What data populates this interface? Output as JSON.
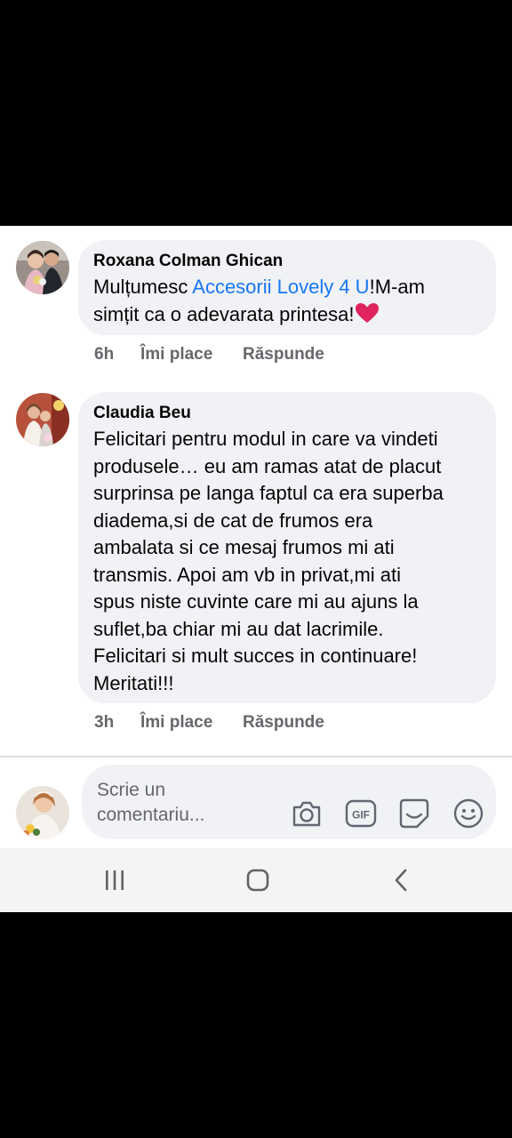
{
  "comments": [
    {
      "author": "Roxana Colman Ghican",
      "text_prefix": "Mulțumesc ",
      "mention": "Accesorii  Lovely 4 U",
      "text_suffix": "!M-am simțit ca o adevarata printesa!",
      "emoji": "❤️",
      "time": "6h",
      "like_label": "Îmi place",
      "reply_label": "Răspunde"
    },
    {
      "author": "Claudia Beu",
      "lines": [
        "Felicitari pentru modul in care va vindeti",
        "produsele… eu am ramas atat de placut",
        "surprinsa pe langa faptul ca era superba",
        "diadema,si de cat de frumos era",
        "ambalata si ce mesaj frumos mi ati",
        "transmis. Apoi am vb in privat,mi ati",
        "spus niste cuvinte care mi au ajuns la",
        "suflet,ba chiar mi au dat lacrimile.",
        "Felicitari si mult succes in continuare!",
        "Meritati!!!"
      ],
      "time": "3h",
      "like_label": "Îmi place",
      "reply_label": "Răspunde"
    }
  ],
  "composer": {
    "placeholder_line1": "Scrie un",
    "placeholder_line2": "comentariu...",
    "icons": [
      "camera-icon",
      "gif-icon",
      "sticker-icon",
      "emoji-icon"
    ]
  },
  "system_nav": {
    "icons": [
      "recent-apps-icon",
      "home-icon",
      "back-icon"
    ]
  },
  "colors": {
    "link": "#1877f2",
    "bubble": "#f0f2f5",
    "meta": "#65676b",
    "heart": "#e0245e"
  }
}
